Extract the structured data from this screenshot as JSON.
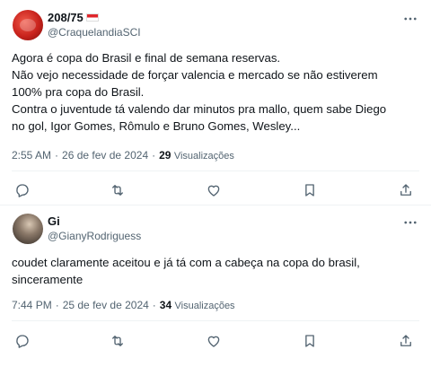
{
  "tweets": [
    {
      "display_name": "208/75",
      "handle": "@CraquelandiaSCI",
      "lines": [
        "Agora é copa do Brasil e final de semana reservas.",
        "Não vejo necessidade de forçar valencia e mercado se não estiverem",
        "100% pra copa do Brasil.",
        "Contra o juventude tá valendo dar minutos pra mallo, quem sabe Diego",
        "no gol, Igor Gomes, Rômulo e Bruno Gomes, Wesley..."
      ],
      "time": "2:55 AM",
      "date": "26 de fev de 2024",
      "views": "29",
      "views_label": "Visualizações"
    },
    {
      "display_name": "Gi",
      "handle": "@GianyRodriguess",
      "lines": [
        "coudet claramente aceitou e já tá com a cabeça na copa do brasil,",
        "sinceramente"
      ],
      "time": "7:44 PM",
      "date": "25 de fev de 2024",
      "views": "34",
      "views_label": "Visualizações"
    }
  ],
  "icons": [
    "more-icon",
    "reply-icon",
    "retweet-icon",
    "like-icon",
    "bookmark-icon",
    "share-icon"
  ],
  "colors": {
    "text": "#0f1419",
    "secondary": "#536471",
    "border": "#eff3f4"
  }
}
